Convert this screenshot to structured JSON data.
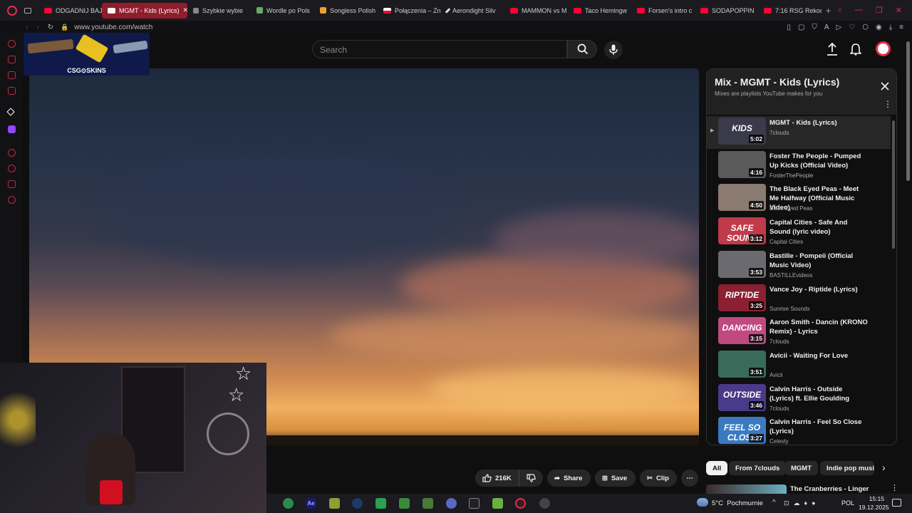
{
  "browser": {
    "tabs": [
      {
        "label": "ODGADNIJ BAJ",
        "active": false
      },
      {
        "label": "MGMT - Kids (Lyrics)",
        "active": true
      },
      {
        "label": "Szybkie wybie",
        "active": false
      },
      {
        "label": "Wordle po Pols",
        "active": false
      },
      {
        "label": "Songless Polish",
        "active": false
      },
      {
        "label": "Połączenia – Zn",
        "active": false
      },
      {
        "label": "Aerondight Silv",
        "active": false
      },
      {
        "label": "MAMMON vs M",
        "active": false
      },
      {
        "label": "Taco Hemingw",
        "active": false
      },
      {
        "label": "Forsen's intro c",
        "active": false
      },
      {
        "label": "SODAPOPPIN",
        "active": false
      },
      {
        "label": "7:16 RSG Rekor",
        "active": false
      }
    ],
    "url": "www.youtube.com/watch"
  },
  "youtube": {
    "search_placeholder": "Search",
    "ad_text": "CSG⊙SKINS",
    "playlist": {
      "title": "Mix - MGMT - Kids (Lyrics)",
      "subtitle": "Mixes are playlists YouTube makes for you",
      "items": [
        {
          "title": "MGMT - Kids (Lyrics)",
          "channel": "7clouds",
          "duration": "5:02",
          "thumb_text": "KIDS",
          "thumb_color": "#3a3a4a",
          "current": true
        },
        {
          "title": "Foster The People - Pumped Up Kicks (Official Video)",
          "channel": "FosterThePeople",
          "duration": "4:16",
          "thumb_text": "",
          "thumb_color": "#5a5a5a",
          "current": false
        },
        {
          "title": "The Black Eyed Peas - Meet Me Halfway (Official Music Video)",
          "channel": "Black Eyed Peas",
          "duration": "4:50",
          "thumb_text": "",
          "thumb_color": "#8a7a70",
          "current": false
        },
        {
          "title": "Capital Cities - Safe And Sound (lyric video)",
          "channel": "Capital Cities",
          "duration": "3:12",
          "thumb_text": "SAFE SOUND",
          "thumb_color": "#c03a4a",
          "current": false
        },
        {
          "title": "Bastille - Pompeii (Official Music Video)",
          "channel": "BASTILLEvideos",
          "duration": "3:53",
          "thumb_text": "",
          "thumb_color": "#6a6a70",
          "current": false
        },
        {
          "title": "Vance Joy - Riptide (Lyrics)",
          "channel": "Sunrise Sounds",
          "duration": "3:25",
          "thumb_text": "RIPTIDE",
          "thumb_color": "#8a2030",
          "current": false
        },
        {
          "title": "Aaron Smith - Dancin (KRONO Remix) - Lyrics",
          "channel": "7clouds",
          "duration": "3:15",
          "thumb_text": "DANCING",
          "thumb_color": "#c04a80",
          "current": false
        },
        {
          "title": "Avicii - Waiting For Love",
          "channel": "Avicii",
          "duration": "3:51",
          "thumb_text": "",
          "thumb_color": "#3a6a5a",
          "current": false
        },
        {
          "title": "Calvin Harris - Outside (Lyrics) ft. Ellie Goulding",
          "channel": "7clouds",
          "duration": "3:46",
          "thumb_text": "OUTSIDE",
          "thumb_color": "#4a3a8a",
          "current": false
        },
        {
          "title": "Calvin Harris - Feel So Close (Lyrics)",
          "channel": "Celesty",
          "duration": "3:27",
          "thumb_text": "FEEL SO CLOSE",
          "thumb_color": "#3a7ac0",
          "current": false
        }
      ]
    },
    "actions": {
      "likes": "216K",
      "share": "Share",
      "save": "Save",
      "clip": "Clip"
    },
    "chips": [
      "All",
      "From 7clouds",
      "MGMT",
      "Indie pop music"
    ],
    "next_video": {
      "title": "The Cranberries - Linger"
    }
  },
  "taskbar": {
    "weather": "5°C  Pochmurnie",
    "lang": "POL",
    "time": "15:15",
    "date": "19.12.2025"
  }
}
